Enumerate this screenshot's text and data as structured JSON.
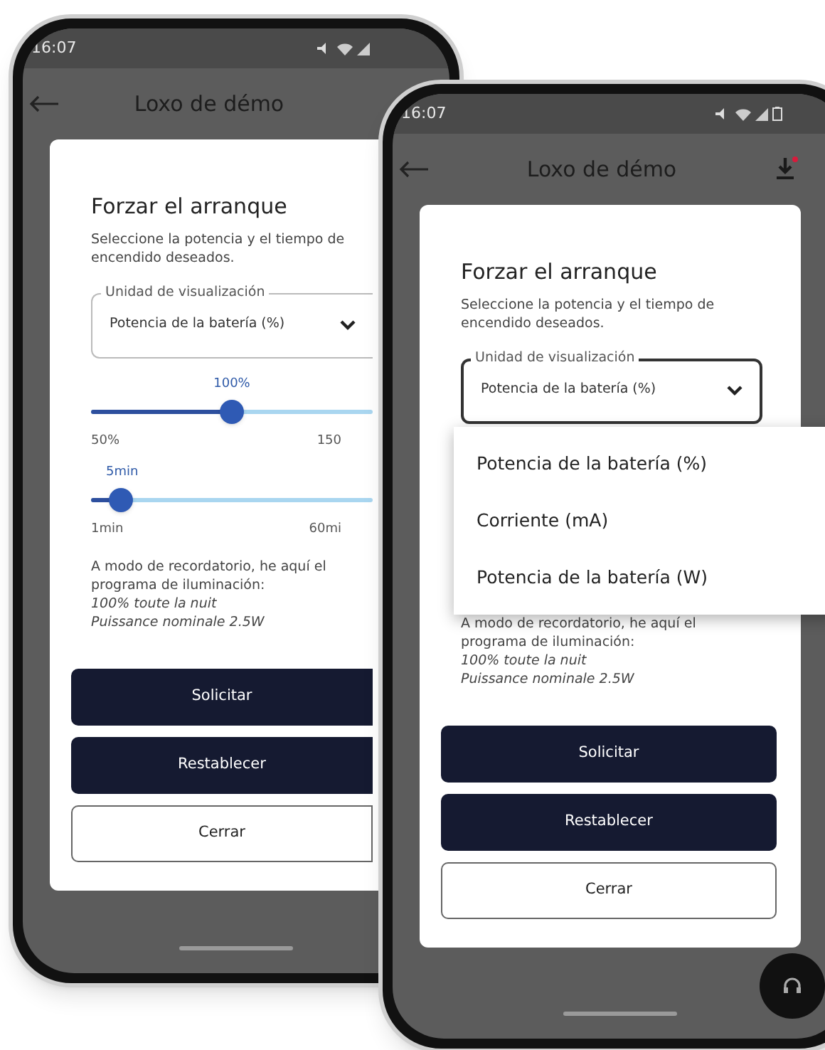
{
  "phones": [
    {
      "status_time": "16:07",
      "title": "Loxo de démo",
      "download_icon": false,
      "dialog": {
        "title": "Forzar el arranque",
        "description": "Seleccione la potencia y el tiempo de encendido deseados.",
        "select": {
          "label": "Unidad de visualización",
          "value": "Potencia de la batería (%)",
          "expanded": false
        },
        "sliders": [
          {
            "value": "100%",
            "level": 0.5,
            "min": "50%",
            "max": "150"
          },
          {
            "value": "5min",
            "level": 0.07,
            "min": "1min",
            "max": "60mi"
          }
        ],
        "note": "A modo de recordatorio, he aquí el programa de iluminación:",
        "note_lines": [
          "100% toute la nuit",
          "Puissance nominale 2.5W"
        ],
        "buttons": [
          {
            "label": "Solicitar",
            "kind": "primary"
          },
          {
            "label": "Restablecer",
            "kind": "primary"
          },
          {
            "label": "Cerrar",
            "kind": "outline"
          }
        ]
      },
      "support_button": false
    },
    {
      "status_time": "16:07",
      "title": "Loxo de démo",
      "download_icon": true,
      "dialog": {
        "title": "Forzar el arranque",
        "description": "Seleccione la potencia y el tiempo de encendido deseados.",
        "select": {
          "label": "Unidad de visualización",
          "value": "Potencia de la batería (%)",
          "expanded": true,
          "options": [
            "Potencia de la batería (%)",
            "Corriente (mA)",
            "Potencia de la batería (W)"
          ]
        },
        "note": "A modo de recordatorio, he aquí el programa de iluminación:",
        "note_lines": [
          "100% toute la nuit",
          "Puissance nominale 2.5W"
        ],
        "buttons": [
          {
            "label": "Solicitar",
            "kind": "primary"
          },
          {
            "label": "Restablecer",
            "kind": "primary"
          },
          {
            "label": "Cerrar",
            "kind": "outline"
          }
        ]
      },
      "support_button": true
    }
  ]
}
